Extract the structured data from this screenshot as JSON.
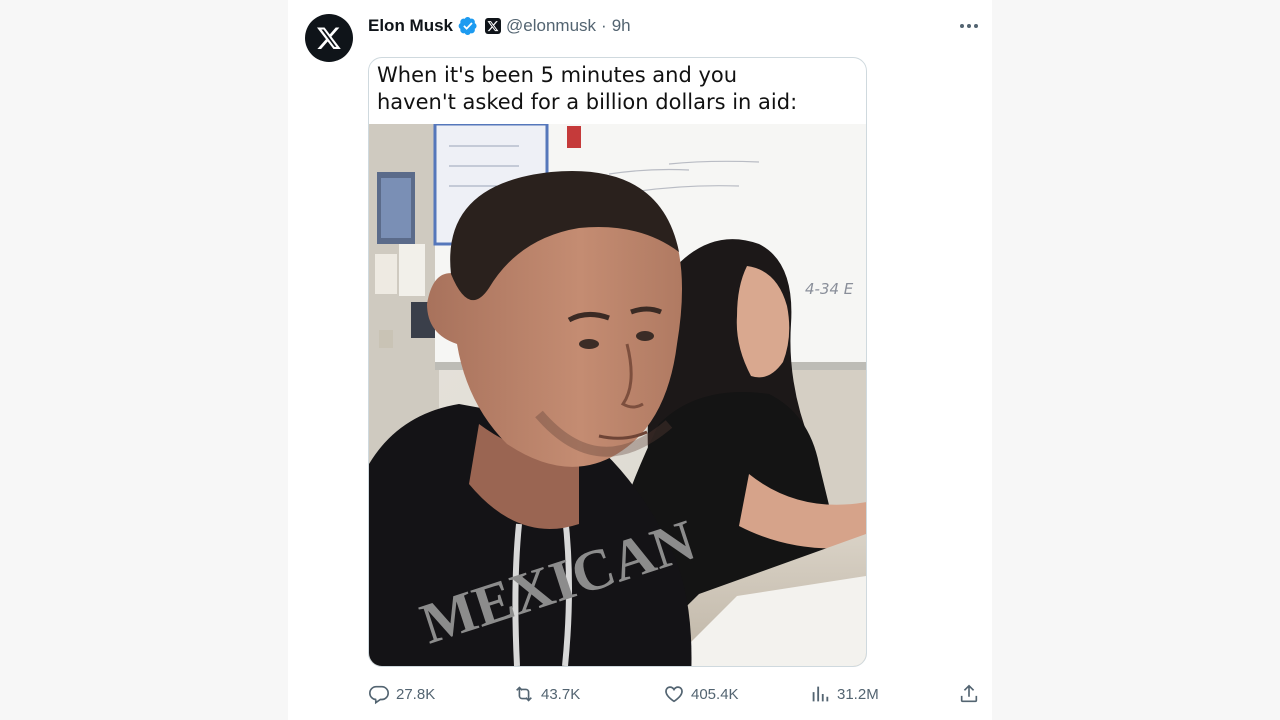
{
  "tweet": {
    "author": {
      "display_name": "Elon Musk",
      "handle": "@elonmusk",
      "verified": true,
      "affiliation_badge": "x-logo-icon",
      "avatar_icon": "x-logo-icon"
    },
    "separator": "·",
    "timestamp": "9h",
    "more_icon": "more-dots-icon",
    "media": {
      "caption_line1": "When it's been 5 minutes and you",
      "caption_line2": "haven't asked for a billion dollars in aid:",
      "photo_whiteboard_text": "4-34 E",
      "photo_hoodie_text": "MEXICAN"
    },
    "actions": {
      "replies": "27.8K",
      "reposts": "43.7K",
      "likes": "405.4K",
      "views": "31.2M",
      "share_icon": "share-icon"
    }
  },
  "colors": {
    "page_background": "#f7f7f7",
    "card_background": "#ffffff",
    "text_primary": "#0f1419",
    "text_secondary": "#536471",
    "verified_blue": "#1d9bf0",
    "border": "#cfd9de"
  }
}
